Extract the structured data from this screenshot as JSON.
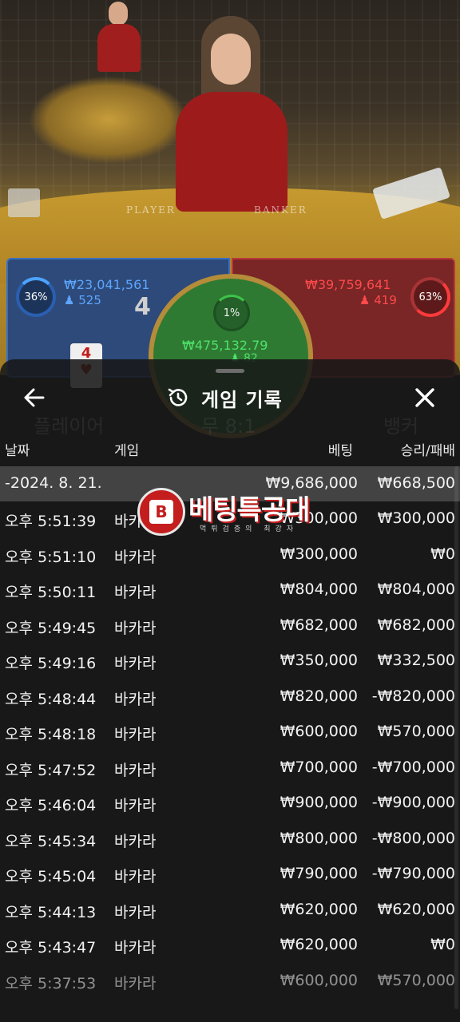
{
  "scene": {
    "player_label": "PLAYER",
    "banker_label": "BANKER"
  },
  "bets": {
    "player": {
      "percent": "36%",
      "amount": "₩23,041,561",
      "count": "525",
      "score": "4",
      "card": "4"
    },
    "tie": {
      "percent": "1%",
      "amount": "₩475,132.79",
      "count": "82"
    },
    "banker": {
      "percent": "63%",
      "amount": "₩39,759,641",
      "count": "419"
    }
  },
  "history": {
    "title": "게임 기록",
    "columns": {
      "date": "날짜",
      "game": "게임",
      "bet": "베팅",
      "win": "승리/패배"
    },
    "ghost_labels": {
      "player": "플레이어",
      "tie": "무 8:1",
      "banker": "뱅커"
    },
    "total": {
      "date": "-2024. 8. 21.",
      "bet": "₩9,686,000",
      "win": "₩668,500"
    },
    "rows": [
      {
        "time": "오후 5:51:39",
        "game": "바카라",
        "bet": "₩300,000",
        "win": "₩300,000"
      },
      {
        "time": "오후 5:51:10",
        "game": "바카라",
        "bet": "₩300,000",
        "win": "₩0"
      },
      {
        "time": "오후 5:50:11",
        "game": "바카라",
        "bet": "₩804,000",
        "win": "₩804,000"
      },
      {
        "time": "오후 5:49:45",
        "game": "바카라",
        "bet": "₩682,000",
        "win": "₩682,000"
      },
      {
        "time": "오후 5:49:16",
        "game": "바카라",
        "bet": "₩350,000",
        "win": "₩332,500"
      },
      {
        "time": "오후 5:48:44",
        "game": "바카라",
        "bet": "₩820,000",
        "win": "-₩820,000"
      },
      {
        "time": "오후 5:48:18",
        "game": "바카라",
        "bet": "₩600,000",
        "win": "₩570,000"
      },
      {
        "time": "오후 5:47:52",
        "game": "바카라",
        "bet": "₩700,000",
        "win": "-₩700,000"
      },
      {
        "time": "오후 5:46:04",
        "game": "바카라",
        "bet": "₩900,000",
        "win": "-₩900,000"
      },
      {
        "time": "오후 5:45:34",
        "game": "바카라",
        "bet": "₩800,000",
        "win": "-₩800,000"
      },
      {
        "time": "오후 5:45:04",
        "game": "바카라",
        "bet": "₩790,000",
        "win": "-₩790,000"
      },
      {
        "time": "오후 5:44:13",
        "game": "바카라",
        "bet": "₩620,000",
        "win": "₩620,000"
      },
      {
        "time": "오후 5:43:47",
        "game": "바카라",
        "bet": "₩620,000",
        "win": "₩0"
      },
      {
        "time": "오후 5:37:53",
        "game": "바카라",
        "bet": "₩600,000",
        "win": "₩570,000"
      }
    ]
  },
  "watermark": {
    "badge": "B",
    "text": "베팅특공대",
    "sub": "먹튀검증의 최강자"
  },
  "colors": {
    "player_blue": "#5da6ff",
    "banker_red": "#ff4a4a",
    "tie_green": "#4fe06a",
    "sheet_bg": "#181818"
  }
}
